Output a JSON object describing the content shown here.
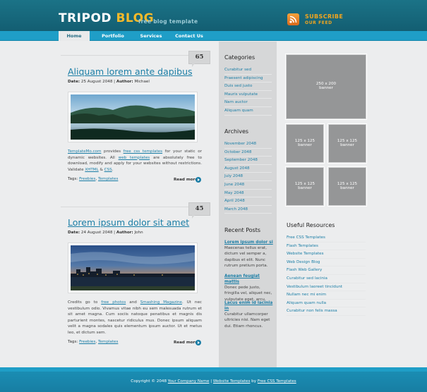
{
  "header": {
    "logo_part1": "TRIPOD",
    "logo_part2": "BLOG",
    "tagline": "free blog template",
    "subscribe_title": "SUBSCRIBE",
    "subscribe_sub": "OUR FEED",
    "rss_icon": "rss-icon"
  },
  "nav": {
    "items": [
      "Home",
      "Portfolio",
      "Services",
      "Contact Us"
    ],
    "active": "Home"
  },
  "posts": [
    {
      "comment_count": "65",
      "title": "Aliquam lorem ante dapibus",
      "date_label": "Date:",
      "date": "25 August 2048",
      "author_label": "Author:",
      "author": "Michael",
      "text": {
        "link1": "TemplateMo.com",
        "t1": " provides ",
        "link2": "free css templates",
        "t2": " for your static or dynamic websites. All ",
        "link3": "web templates",
        "t3": " are absolutely free to download, modify and apply for your websites without restrictions. Validate ",
        "link4": "XHTML",
        "t4": " & ",
        "link5": "CSS",
        "t5": "."
      },
      "tags_label": "Tags:",
      "tag1": "Freebies",
      "tag_sep": ", ",
      "tag2": "Templates",
      "read_more": "Read more"
    },
    {
      "comment_count": "45",
      "title": "Lorem ipsum dolor sit amet",
      "date_label": "Date:",
      "date": "24 August 2048",
      "author_label": "Author:",
      "author": "John",
      "text": {
        "t0": "Credits go to ",
        "link1": "free photos",
        "t1": " and ",
        "link2": "Smashing Magazine",
        "t2": ". Ut nec vestibulum odio. Vivamus vitae nibh eu sem malesuada rutrum et sit amet magna. Cum sociis natoque penatibus et magnis dis parturient montes, nascetur ridiculus mus. Donec ipsum aliquam velit a magna sodales quis elementum ipsum auctor. Ut et metus leo, et dictum sem."
      },
      "tags_label": "Tags:",
      "tag1": "Freebies",
      "tag_sep": ", ",
      "tag2": "Templates",
      "read_more": "Read more"
    }
  ],
  "categories": {
    "heading": "Categories",
    "items": [
      "Curabitur sed",
      "Praesent adipiscing",
      "Duis sed justo",
      "Mauris vulputate",
      "Nam auctor",
      "Aliquam quam"
    ]
  },
  "archives": {
    "heading": "Archives",
    "items": [
      "November 2048",
      "October 2048",
      "September 2048",
      "August 2048",
      "July 2048",
      "June 2048",
      "May 2048",
      "April 2048",
      "March 2048"
    ]
  },
  "recent_posts": {
    "heading": "Recent Posts",
    "items": [
      {
        "title": "Lorem ipsum dolor si",
        "body": "Maecenas tellus erat, dictum vel semper a, dapibus et elit. Nunc rutrum pretium porta."
      },
      {
        "title": "Aenean feugiat mattis",
        "body": "Donec pede justo, fringilla vel, aliquet nec, vulputate eget, arcu."
      },
      {
        "title": "Lacus enim id lacinia in",
        "body": "Curabitur ullamcorper ultricies nisi. Nam eget dui. Etiam rhoncus."
      }
    ]
  },
  "banners": {
    "large": {
      "size": "250 x 200",
      "label": "banner"
    },
    "small": [
      {
        "size": "125 x 125",
        "label": "banner"
      },
      {
        "size": "125 x 125",
        "label": "banner"
      },
      {
        "size": "125 x 125",
        "label": "banner"
      },
      {
        "size": "125 x 125",
        "label": "banner"
      }
    ]
  },
  "useful": {
    "heading": "Useful Resources",
    "items": [
      "Free CSS Templates",
      "Flash Templates",
      "Website Templates",
      "Web Design Blog",
      "Flash Web Gallery",
      "Curabitur sed lacinia",
      "Vestibulum laoreet tincidunt",
      "Nullam nec mi enim",
      "Aliquam quam nulla",
      "Curabitur non felis massa"
    ]
  },
  "footer": {
    "t1": "Copyright © 2048 ",
    "link1": "Your Company Name",
    "t2": " | ",
    "link2": "Website Templates",
    "t3": " by ",
    "link3": "Free CSS Templates"
  },
  "colors": {
    "header": "#1b7387",
    "nav": "#1f9ec7",
    "link": "#1b7ea6",
    "logo_accent": "#f6ba2a",
    "subscribe": "#f2a51e"
  }
}
